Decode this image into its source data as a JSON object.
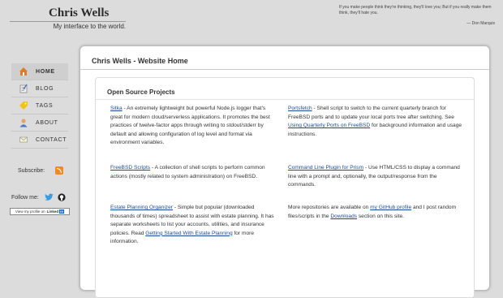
{
  "header": {
    "site_title": "Chris Wells",
    "tagline": "My interface to the world.",
    "quote": "If you make people think they're thinking, they'll love you; But if you really make them think, they'll hate you.",
    "quote_author": "— Don Marquis"
  },
  "nav": {
    "items": [
      {
        "label": "HOME",
        "icon": "home-icon",
        "active": true
      },
      {
        "label": "BLOG",
        "icon": "blog-icon"
      },
      {
        "label": "TAGS",
        "icon": "tags-icon"
      },
      {
        "label": "ABOUT",
        "icon": "about-icon"
      },
      {
        "label": "CONTACT",
        "icon": "contact-icon"
      }
    ],
    "subscribe_label": "Subscribe:",
    "follow_label": "Follow me:",
    "linkedin_text": "View my profile on",
    "linkedin_brand": "Linked",
    "linkedin_in": "in"
  },
  "main": {
    "title": "Chris Wells - Website Home",
    "section_title": "Open Source Projects",
    "projects": [
      {
        "name": "Sitka",
        "desc": " - An extremely lightweight but powerful Node.js logger that's great for modern cloud/serverless applications. It promotes the best practices of twelve-factor apps through writing to stdout/stderr by default and allowing configuration of log level and format via environment variables."
      },
      {
        "name": "Portsfetch",
        "desc": " - Shell script to switch to the current quarterly branch for FreeBSD ports and to update your local ports tree after switching. See ",
        "link2": "Using Quarterly Ports on FreeBSD",
        "desc2": " for background information and usage instructions."
      },
      {
        "name": "FreeBSD Scripts",
        "desc": " - A collection of shell scripts to perform common actions (mostly related to system administration) on FreeBSD."
      },
      {
        "name": "Command Line Plugin for Prism",
        "desc": " - Use HTML/CSS to display a command line with a prompt and, optionally, the output/response from the commands."
      },
      {
        "name": "Estate Planning Organizer",
        "desc": " - Simple but popular (downloaded thousands of times) spreadsheet to assist with estate planning. It has separate worksheets to list your accounts, utilities, and insurance policies. Read ",
        "link2": "Getting Started With Estate Planning",
        "desc2": " for more information."
      },
      {
        "pre": "More repositories are available on ",
        "name": "my GitHub profile",
        "desc": " and I post random files/scripts in the ",
        "link2": "Downloads",
        "desc2": " section on this site."
      }
    ]
  },
  "colors": {
    "link": "#1a4a9c",
    "background": "#dcdcdc",
    "rss": "#f08a24",
    "linkedin": "#0a66c2"
  }
}
